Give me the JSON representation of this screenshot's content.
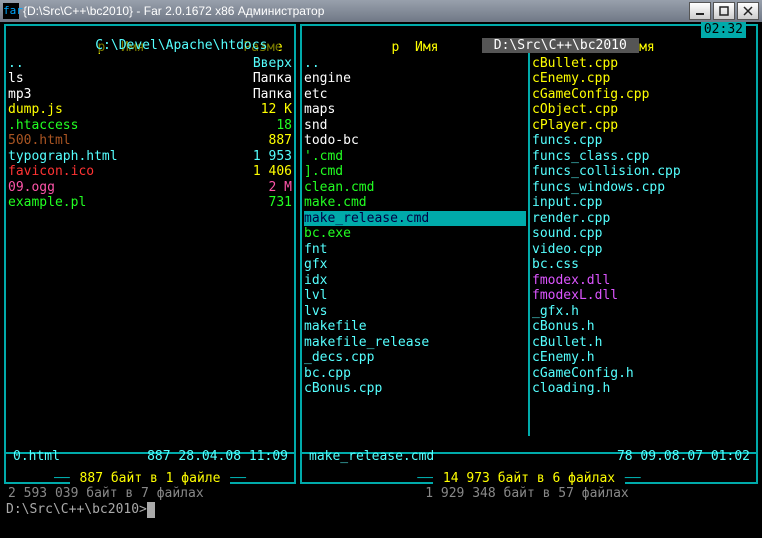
{
  "window": {
    "title": "{D:\\Src\\C++\\bc2010} - Far 2.0.1672 x86 Администратор",
    "icon_text": "far"
  },
  "clock": "02:32",
  "prompt": "D:\\Src\\C++\\bc2010>",
  "left_panel": {
    "path": " C:\\Devel\\Apache\\htdocs ",
    "active": false,
    "cols": [
      {
        "head": "р  Имя",
        "head2": "Разме"
      }
    ],
    "rows": [
      {
        "name": "..",
        "size": "Вверх",
        "cls": "c-cyan"
      },
      {
        "name": "ls",
        "size": "Папка",
        "cls": "c-white"
      },
      {
        "name": "mp3",
        "size": "Папка",
        "cls": "c-white"
      },
      {
        "name": "dump.js",
        "size": "12 K",
        "cls": "c-yellow"
      },
      {
        "name": ".htaccess",
        "size": "18",
        "cls": "c-bgreen"
      },
      {
        "name": "500.html",
        "size": "887",
        "cls": "c-brown",
        "sel": false,
        "ysize": true
      },
      {
        "name": "typograph.html",
        "size": "1 953",
        "cls": "c-cyan"
      },
      {
        "name": "favicon.ico",
        "size": "1 406",
        "cls": "c-red",
        "ysize": true
      },
      {
        "name": "09.ogg",
        "size": "2 M",
        "cls": "c-pink"
      },
      {
        "name": "example.pl",
        "size": "731",
        "cls": "c-bgreen"
      }
    ],
    "status": {
      "name": "0.html",
      "info": "887 28.04.08 11:09"
    },
    "size_label": " 887 байт в 1 файле ",
    "summary": " 2 593 039 байт в 7 файлах "
  },
  "right_panel": {
    "path": " D:\\Src\\C++\\bc2010 ",
    "active": true,
    "cols": [
      {
        "head": "р  Имя"
      },
      {
        "head": "Имя"
      }
    ],
    "rows_l": [
      {
        "name": "..",
        "cls": "c-cyan"
      },
      {
        "name": "engine",
        "cls": "c-white"
      },
      {
        "name": "etc",
        "cls": "c-white"
      },
      {
        "name": "maps",
        "cls": "c-white"
      },
      {
        "name": "snd",
        "cls": "c-white"
      },
      {
        "name": "todo-bc",
        "cls": "c-white"
      },
      {
        "name": "'.cmd",
        "cls": "c-bgreen"
      },
      {
        "name": "].cmd",
        "cls": "c-bgreen"
      },
      {
        "name": "clean.cmd",
        "cls": "c-bgreen"
      },
      {
        "name": "make.cmd",
        "cls": "c-bgreen"
      },
      {
        "name": "make_release.cmd",
        "cls": "c-bgreen",
        "sel": true
      },
      {
        "name": "bc.exe",
        "cls": "c-bgreen"
      },
      {
        "name": "fnt",
        "cls": "c-cyan"
      },
      {
        "name": "gfx",
        "cls": "c-cyan"
      },
      {
        "name": "idx",
        "cls": "c-cyan"
      },
      {
        "name": "lvl",
        "cls": "c-cyan"
      },
      {
        "name": "lvs",
        "cls": "c-cyan"
      },
      {
        "name": "makefile",
        "cls": "c-cyan"
      },
      {
        "name": "makefile_release",
        "cls": "c-cyan"
      },
      {
        "name": "_decs.cpp",
        "cls": "c-cyan"
      },
      {
        "name": "bc.cpp",
        "cls": "c-cyan"
      },
      {
        "name": "cBonus.cpp",
        "cls": "c-cyan"
      }
    ],
    "rows_r": [
      {
        "name": "cBullet.cpp",
        "cls": "c-yellow"
      },
      {
        "name": "cEnemy.cpp",
        "cls": "c-yellow"
      },
      {
        "name": "cGameConfig.cpp",
        "cls": "c-yellow"
      },
      {
        "name": "cObject.cpp",
        "cls": "c-yellow"
      },
      {
        "name": "cPlayer.cpp",
        "cls": "c-yellow"
      },
      {
        "name": "funcs.cpp",
        "cls": "c-cyan"
      },
      {
        "name": "funcs_class.cpp",
        "cls": "c-cyan"
      },
      {
        "name": "funcs_collision.cpp",
        "cls": "c-cyan"
      },
      {
        "name": "funcs_windows.cpp",
        "cls": "c-cyan"
      },
      {
        "name": "input.cpp",
        "cls": "c-cyan"
      },
      {
        "name": "render.cpp",
        "cls": "c-cyan"
      },
      {
        "name": "sound.cpp",
        "cls": "c-cyan"
      },
      {
        "name": "video.cpp",
        "cls": "c-cyan"
      },
      {
        "name": "bc.css",
        "cls": "c-cyan"
      },
      {
        "name": "fmodex.dll",
        "cls": "c-mag"
      },
      {
        "name": "fmodexL.dll",
        "cls": "c-mag"
      },
      {
        "name": "_gfx.h",
        "cls": "c-cyan"
      },
      {
        "name": "cBonus.h",
        "cls": "c-cyan"
      },
      {
        "name": "cBullet.h",
        "cls": "c-cyan"
      },
      {
        "name": "cEnemy.h",
        "cls": "c-cyan"
      },
      {
        "name": "cGameConfig.h",
        "cls": "c-cyan"
      },
      {
        "name": "cloading.h",
        "cls": "c-cyan"
      }
    ],
    "status": {
      "name": "make_release.cmd",
      "info": "78 09.08.07 01:02"
    },
    "size_label": " 14 973 байт в 6 файлах ",
    "summary": " 1 929 348 байт в 57 файлах "
  }
}
